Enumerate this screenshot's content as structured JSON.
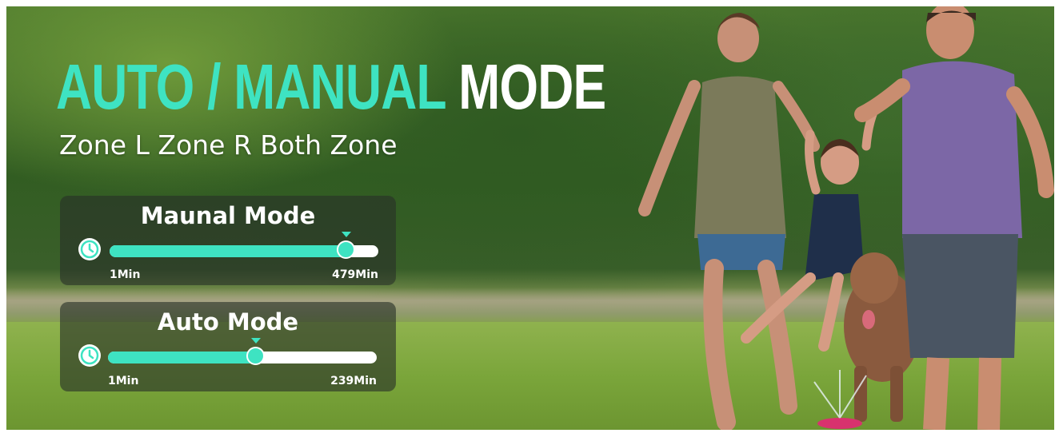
{
  "headline": {
    "accent_text": "AUTO / MANUAL",
    "plain_text": " MODE"
  },
  "subtitle": "Zone L Zone R Both Zone",
  "panels": [
    {
      "title": "Maunal Mode",
      "min_label": "1Min",
      "max_label": "479Min",
      "level": 0.88,
      "icon": "clock-icon"
    },
    {
      "title": "Auto Mode",
      "min_label": "1Min",
      "max_label": "239Min",
      "level": 0.55,
      "icon": "clock-icon"
    }
  ],
  "colors": {
    "accent": "#3ee3c2",
    "text": "#ffffff",
    "panel_bg": "rgba(40,48,40,0.62)"
  }
}
